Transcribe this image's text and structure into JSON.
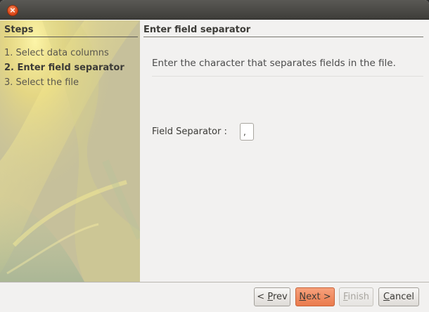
{
  "window": {
    "close_glyph": "×"
  },
  "steps": {
    "title": "Steps",
    "items": [
      {
        "label": "1. Select data columns",
        "current": false
      },
      {
        "label": "2. Enter field separator",
        "current": true
      },
      {
        "label": "3. Select the file",
        "current": false
      }
    ]
  },
  "main": {
    "title": "Enter field separator",
    "description": "Enter the character that separates fields in the file.",
    "field_label": "Field Separator :",
    "field_value": ","
  },
  "buttons": {
    "prev": {
      "prefix": "< ",
      "mnemonic": "P",
      "rest": "rev"
    },
    "next": {
      "mnemonic": "N",
      "rest": "ext >"
    },
    "finish": {
      "mnemonic": "F",
      "rest": "inish"
    },
    "cancel": {
      "mnemonic": "C",
      "rest": "ancel"
    }
  },
  "colors": {
    "accent_button": "#ea7b4d",
    "close_button": "#df4a1a",
    "sidebar_bg": "#c7c29c"
  },
  "icons": {
    "close": "close-icon"
  }
}
